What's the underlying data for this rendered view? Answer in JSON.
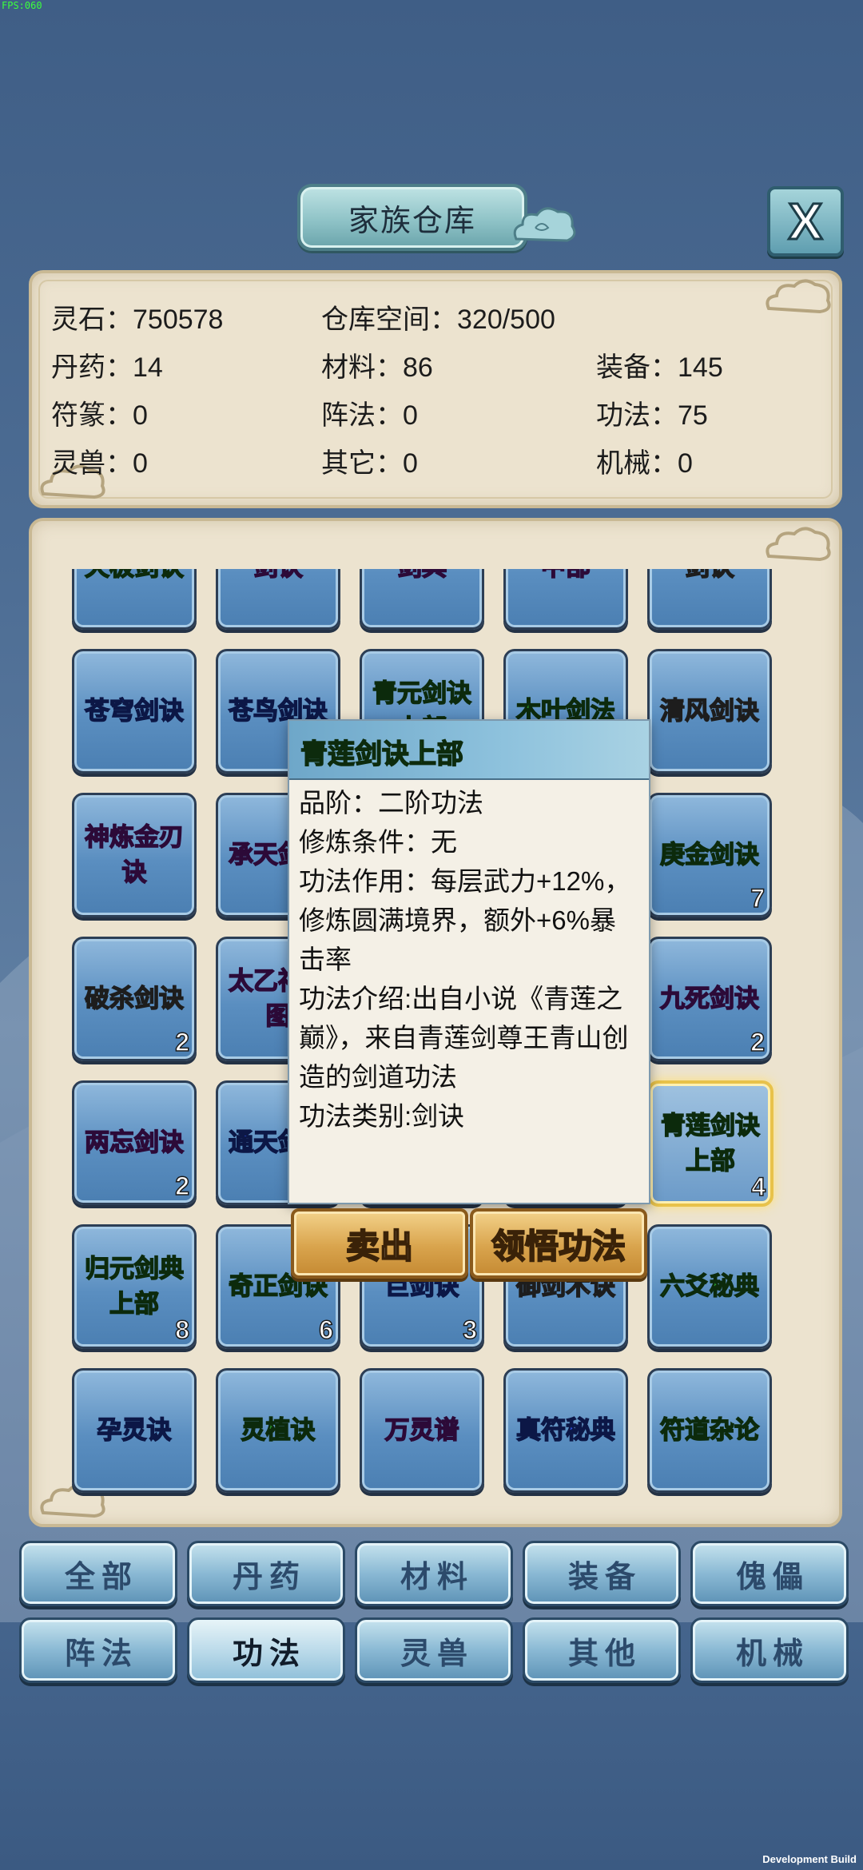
{
  "status": {
    "fps": "FPS:060",
    "build": "Development Build"
  },
  "header": {
    "title": "家族仓库",
    "close_label": "X"
  },
  "stats": {
    "spirit_stone": "灵石：750578",
    "storage_space": "仓库空间：320/500",
    "pills": "丹药：14",
    "materials": "材料：86",
    "equipment": "装备：145",
    "talismans": "符篆：0",
    "formations": "阵法：0",
    "techniques": "功法：75",
    "spirit_beasts": "灵兽：0",
    "others": "其它：0",
    "machinery": "机械：0"
  },
  "grid": {
    "items": [
      {
        "name": "天极剑诀",
        "count": "",
        "quality": "green"
      },
      {
        "name": "剑诀",
        "count": "",
        "quality": "purple"
      },
      {
        "name": "剑典",
        "count": "",
        "quality": "purple"
      },
      {
        "name": "中部",
        "count": "",
        "quality": "purple"
      },
      {
        "name": "剑诀",
        "count": "",
        "quality": "white"
      },
      {
        "name": "苍穹剑诀",
        "count": "",
        "quality": "blue"
      },
      {
        "name": "苍鸟剑诀",
        "count": "",
        "quality": "blue"
      },
      {
        "name": "青元剑诀上部",
        "count": "",
        "quality": "green"
      },
      {
        "name": "木叶剑法",
        "count": "",
        "quality": "green"
      },
      {
        "name": "清风剑诀",
        "count": "",
        "quality": "white"
      },
      {
        "name": "神炼金刃诀",
        "count": "",
        "quality": "purple"
      },
      {
        "name": "承天剑诀",
        "count": "",
        "quality": "purple"
      },
      {
        "name": "",
        "count": "",
        "quality": "blue"
      },
      {
        "name": "",
        "count": "",
        "quality": "blue"
      },
      {
        "name": "庚金剑诀",
        "count": "7",
        "quality": "green"
      },
      {
        "name": "破杀剑诀",
        "count": "2",
        "quality": "white"
      },
      {
        "name": "太乙神剑图",
        "count": "",
        "quality": "purple"
      },
      {
        "name": "",
        "count": "",
        "quality": "blue"
      },
      {
        "name": "",
        "count": "",
        "quality": "blue"
      },
      {
        "name": "九死剑诀",
        "count": "2",
        "quality": "purple"
      },
      {
        "name": "两忘剑诀",
        "count": "2",
        "quality": "purple"
      },
      {
        "name": "通天剑诀",
        "count": "",
        "quality": "blue"
      },
      {
        "name": "",
        "count": "",
        "quality": "blue"
      },
      {
        "name": "",
        "count": "",
        "quality": "blue"
      },
      {
        "name": "青莲剑诀上部",
        "count": "4",
        "quality": "green",
        "selected": true
      },
      {
        "name": "归元剑典上部",
        "count": "8",
        "quality": "green"
      },
      {
        "name": "奇正剑诀",
        "count": "6",
        "quality": "green"
      },
      {
        "name": "巨剑诀",
        "count": "3",
        "quality": "blue"
      },
      {
        "name": "御剑术诀",
        "count": "",
        "quality": "white"
      },
      {
        "name": "六爻秘典",
        "count": "",
        "quality": "green"
      },
      {
        "name": "孕灵诀",
        "count": "",
        "quality": "blue"
      },
      {
        "name": "灵植诀",
        "count": "",
        "quality": "green"
      },
      {
        "name": "万灵谱",
        "count": "",
        "quality": "purple"
      },
      {
        "name": "真符秘典",
        "count": "",
        "quality": "blue"
      },
      {
        "name": "符道杂论",
        "count": "",
        "quality": "green"
      }
    ]
  },
  "tooltip": {
    "title": "青莲剑诀上部",
    "grade": "品阶：二阶功法",
    "requirement": "修炼条件：无",
    "effect": "功法作用：每层武力+12%，修炼圆满境界，额外+6%暴击率",
    "intro": "功法介绍:出自小说《青莲之巅》，来自青莲剑尊王青山创造的剑道功法",
    "category": "功法类别:剑诀",
    "sell_label": "卖出",
    "learn_label": "领悟功法"
  },
  "tabs": [
    {
      "label": "全部",
      "active": false
    },
    {
      "label": "丹药",
      "active": false
    },
    {
      "label": "材料",
      "active": false
    },
    {
      "label": "装备",
      "active": false
    },
    {
      "label": "傀儡",
      "active": false
    },
    {
      "label": "阵法",
      "active": false
    },
    {
      "label": "功法",
      "active": true
    },
    {
      "label": "灵兽",
      "active": false
    },
    {
      "label": "其他",
      "active": false
    },
    {
      "label": "机械",
      "active": false
    }
  ],
  "colors": {
    "white": "#ffffff",
    "green": "#2c9a2c",
    "blue": "#2f4fe0",
    "purple": "#c035e6",
    "highlight": "#e8c24a"
  }
}
